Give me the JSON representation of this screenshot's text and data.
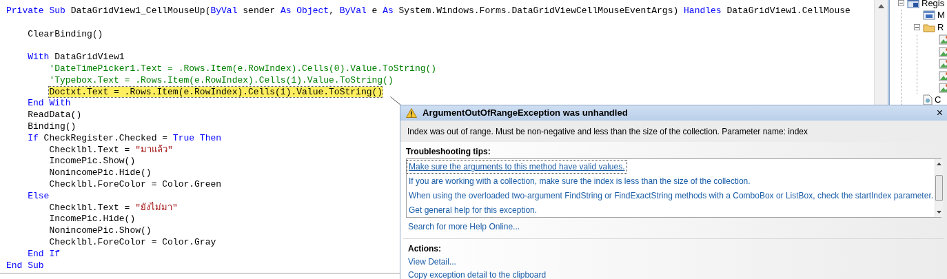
{
  "code": {
    "lines": [
      {
        "highlighted": false,
        "tokens": [
          {
            "kind": "keyword",
            "text": "Private Sub"
          },
          {
            "kind": "plain",
            "text": " DataGridView1_CellMouseUp("
          },
          {
            "kind": "keyword",
            "text": "ByVal"
          },
          {
            "kind": "plain",
            "text": " sender "
          },
          {
            "kind": "keyword",
            "text": "As Object"
          },
          {
            "kind": "plain",
            "text": ", "
          },
          {
            "kind": "keyword",
            "text": "ByVal"
          },
          {
            "kind": "plain",
            "text": " e "
          },
          {
            "kind": "keyword",
            "text": "As"
          },
          {
            "kind": "plain",
            "text": " System.Windows.Forms.DataGridViewCellMouseEventArgs) "
          },
          {
            "kind": "keyword",
            "text": "Handles"
          },
          {
            "kind": "plain",
            "text": " DataGridView1.CellMouse"
          }
        ],
        "children": [
          {
            "kind": "blank"
          },
          {
            "kind": "code",
            "highlighted": false,
            "tokens": [
              {
                "kind": "plain",
                "text": "ClearBinding()"
              }
            ]
          },
          {
            "kind": "blank"
          },
          {
            "highlighted": false,
            "tokens": [
              {
                "kind": "keyword",
                "text": "With"
              },
              {
                "kind": "plain",
                "text": " DataGridView1"
              }
            ],
            "children": [
              {
                "highlighted": false,
                "tokens": [
                  {
                    "kind": "comment",
                    "text": "'DateTimePicker1.Text = .Rows.Item(e.RowIndex).Cells(0).Value.ToString()"
                  }
                ]
              },
              {
                "highlighted": false,
                "tokens": [
                  {
                    "kind": "comment",
                    "text": "'Typebox.Text = .Rows.Item(e.RowIndex).Cells(1).Value.ToString()"
                  }
                ]
              },
              {
                "highlighted": true,
                "tokens": [
                  {
                    "kind": "plain",
                    "text": "Doctxt.Text = .Rows.Item(e.RowIndex).Cells(1).Value.ToString()"
                  }
                ]
              }
            ]
          },
          {
            "highlighted": false,
            "tokens": [
              {
                "kind": "keyword",
                "text": "End With"
              }
            ]
          },
          {
            "highlighted": false,
            "tokens": [
              {
                "kind": "plain",
                "text": "ReadData()"
              }
            ]
          },
          {
            "highlighted": false,
            "tokens": [
              {
                "kind": "plain",
                "text": "Binding()"
              }
            ]
          },
          {
            "highlighted": false,
            "tokens": [
              {
                "kind": "keyword",
                "text": "If"
              },
              {
                "kind": "plain",
                "text": " CheckRegister.Checked = "
              },
              {
                "kind": "keyword",
                "text": "True Then"
              }
            ],
            "children": [
              {
                "highlighted": false,
                "tokens": [
                  {
                    "kind": "plain",
                    "text": "Checklbl.Text = "
                  },
                  {
                    "kind": "string",
                    "text": "\"มาแล้ว\""
                  }
                ]
              },
              {
                "highlighted": false,
                "tokens": [
                  {
                    "kind": "plain",
                    "text": "IncomePic.Show()"
                  }
                ]
              },
              {
                "highlighted": false,
                "tokens": [
                  {
                    "kind": "plain",
                    "text": "NonincomePic.Hide()"
                  }
                ]
              },
              {
                "highlighted": false,
                "tokens": [
                  {
                    "kind": "plain",
                    "text": "Checklbl.ForeColor = Color.Green"
                  }
                ]
              }
            ]
          },
          {
            "highlighted": false,
            "tokens": [
              {
                "kind": "keyword",
                "text": "Else"
              }
            ],
            "children": [
              {
                "highlighted": false,
                "tokens": [
                  {
                    "kind": "plain",
                    "text": "Checklbl.Text = "
                  },
                  {
                    "kind": "string",
                    "text": "\"ยังไม่มา\""
                  }
                ]
              },
              {
                "highlighted": false,
                "tokens": [
                  {
                    "kind": "plain",
                    "text": "IncomePic.Hide()"
                  }
                ]
              },
              {
                "highlighted": false,
                "tokens": [
                  {
                    "kind": "plain",
                    "text": "NonincomePic.Show()"
                  }
                ]
              },
              {
                "highlighted": false,
                "tokens": [
                  {
                    "kind": "plain",
                    "text": "Checklbl.ForeColor = Color.Gray"
                  }
                ]
              }
            ]
          },
          {
            "highlighted": false,
            "tokens": [
              {
                "kind": "keyword",
                "text": "End If"
              }
            ]
          }
        ]
      },
      {
        "highlighted": false,
        "tokens": [
          {
            "kind": "keyword",
            "text": "End Sub"
          }
        ]
      }
    ]
  },
  "solution_tree": {
    "nodes": [
      {
        "kind": "project",
        "label": "Regis",
        "expanded": true,
        "children": [
          {
            "kind": "form",
            "label": "M"
          },
          {
            "kind": "folder",
            "label": "R",
            "expanded": true,
            "children": [
              {
                "kind": "image"
              },
              {
                "kind": "image"
              },
              {
                "kind": "image"
              },
              {
                "kind": "image"
              },
              {
                "kind": "image"
              }
            ]
          },
          {
            "kind": "file",
            "label": "C"
          }
        ]
      }
    ]
  },
  "exception": {
    "title": "ArgumentOutOfRangeException was unhandled",
    "close": "×",
    "message": "Index was out of range. Must be non-negative and less than the size of the collection. Parameter name: index",
    "tips_heading": "Troubleshooting tips:",
    "tips": [
      {
        "text": "Make sure the arguments to this method have valid values.",
        "selected": true
      },
      {
        "text": "If you are working with a collection, make sure the index is less than the size of the collection.",
        "selected": false
      },
      {
        "text": "When using the overloaded two-argument FindString or FindExactString methods with a ComboBox or ListBox, check the startIndex parameter.",
        "selected": false
      },
      {
        "text": "Get general help for this exception.",
        "selected": false
      }
    ],
    "search_link": "Search for more Help Online...",
    "actions_heading": "Actions:",
    "actions": [
      "View Detail...",
      "Copy exception detail to the clipboard"
    ]
  }
}
